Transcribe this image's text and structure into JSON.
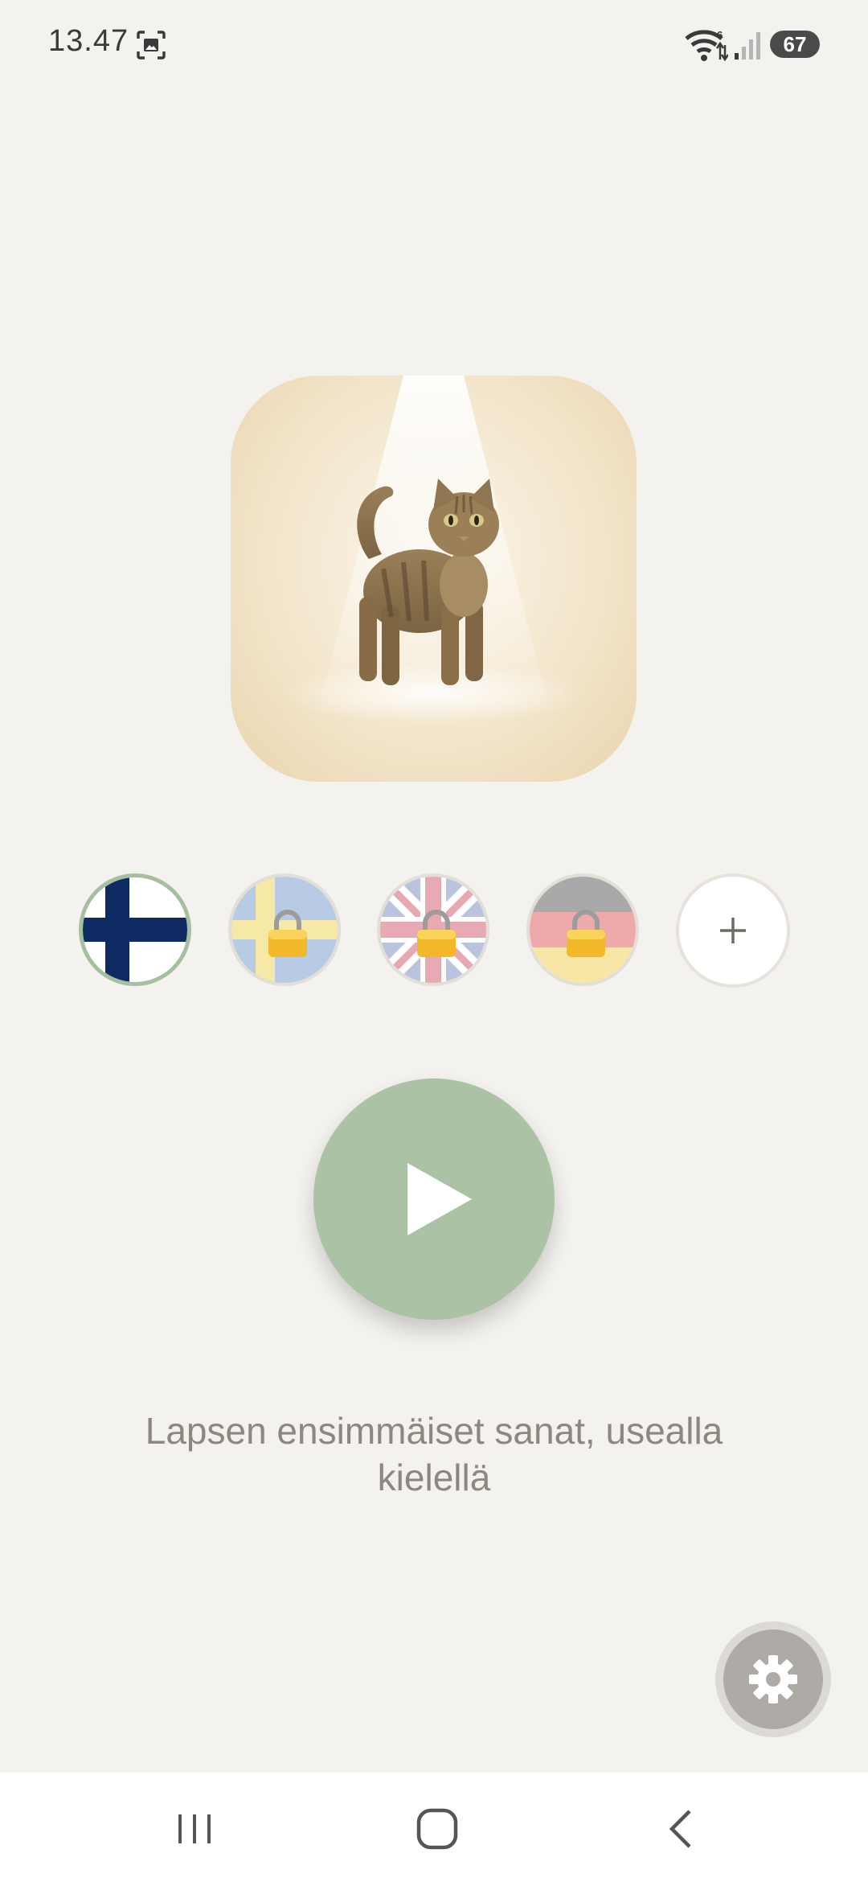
{
  "status_bar": {
    "time": "13.47",
    "battery": "67",
    "icons": [
      "screenshot-icon",
      "wifi-icon",
      "signal-icon",
      "battery-icon"
    ]
  },
  "word_card": {
    "image": "cat-illustration"
  },
  "languages": [
    {
      "name": "fi",
      "flag": "finland-flag-icon",
      "selected": true,
      "locked": false
    },
    {
      "name": "sv",
      "flag": "sweden-flag-icon",
      "selected": false,
      "locked": true
    },
    {
      "name": "en",
      "flag": "uk-flag-icon",
      "selected": false,
      "locked": true
    },
    {
      "name": "de",
      "flag": "germany-flag-icon",
      "selected": false,
      "locked": true
    }
  ],
  "add_language": {
    "label": "+"
  },
  "play": {
    "icon": "play-icon"
  },
  "tagline": "Lapsen ensimmäiset sanat, usealla kielellä",
  "settings": {
    "icon": "gear-icon"
  },
  "nav": {
    "icons": [
      "recents-icon",
      "home-icon",
      "back-icon"
    ]
  },
  "colors": {
    "background": "#f4f2ee",
    "accent_green": "#abc2a5",
    "selected_ring": "#a6bf9f",
    "text_muted": "#8c877f",
    "card": "#f3e6cc"
  }
}
